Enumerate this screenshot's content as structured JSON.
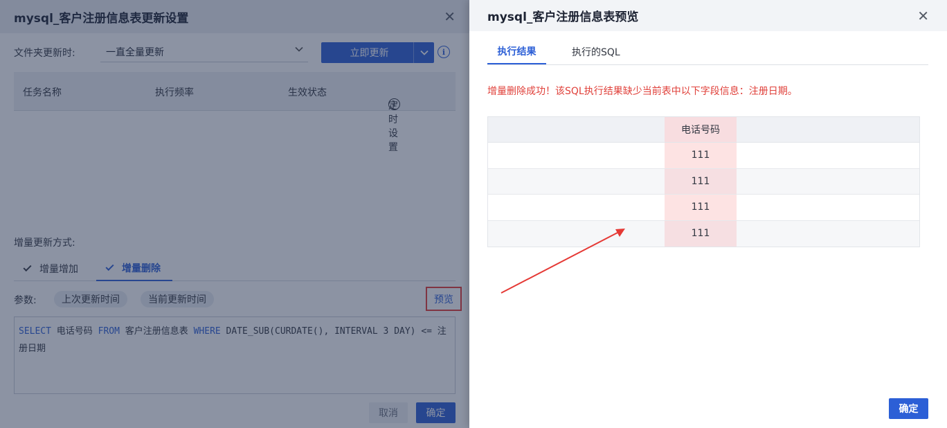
{
  "left_dialog": {
    "title": "mysql_客户注册信息表更新设置",
    "folder_update_label": "文件夹更新时:",
    "folder_update_value": "一直全量更新",
    "update_now_label": "立即更新",
    "task_table": {
      "col_name": "任务名称",
      "col_frequency": "执行频率",
      "col_status": "生效状态",
      "schedule_label": "定时设置"
    },
    "incremental_label": "增量更新方式:",
    "tabs": [
      {
        "label": "增量增加",
        "active": false
      },
      {
        "label": "增量删除",
        "active": true
      }
    ],
    "params_label": "参数:",
    "param_chips": [
      "上次更新时间",
      "当前更新时间"
    ],
    "preview_label": "预览",
    "sql": {
      "kw1": "SELECT",
      "t1": " 电话号码 ",
      "kw2": "FROM",
      "t2": " 客户注册信息表 ",
      "kw3": "WHERE",
      "t3": " DATE_SUB(CURDATE(), INTERVAL 3 DAY) <= 注册日期"
    },
    "cancel_label": "取消",
    "confirm_label": "确定"
  },
  "right_panel": {
    "title": "mysql_客户注册信息表预览",
    "tabs": [
      {
        "label": "执行结果",
        "active": true
      },
      {
        "label": "执行的SQL",
        "active": false
      }
    ],
    "message": "增量删除成功！该SQL执行结果缺少当前表中以下字段信息：注册日期。",
    "table": {
      "column": "电话号码",
      "rows": [
        "111",
        "111",
        "111",
        "111"
      ]
    },
    "confirm_label": "确定"
  },
  "colors": {
    "primary": "#2c5fd6",
    "error_text": "#e0403a",
    "highlight_column": "#fde3e3",
    "annotation_red": "#e53935"
  }
}
